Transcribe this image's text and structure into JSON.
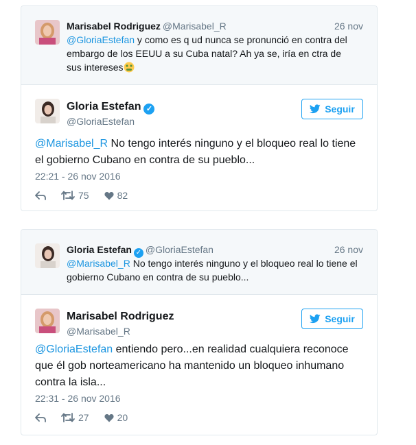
{
  "colors": {
    "link": "#1b95e0",
    "brand": "#1da1f2",
    "muted": "#657786"
  },
  "cards": [
    {
      "parent": {
        "name": "Marisabel Rodriguez",
        "handle": "@Marisabel_R",
        "date": "26 nov",
        "mention": "@GloriaEstefan",
        "text_lines": [
          " y como es q ud nunca se pronunció en contra del",
          "embargo de los EEUU a su Cuba natal? Ah ya se, iría en ctra de",
          "sus intereses"
        ],
        "emoji": "money-mouth-face-icon"
      },
      "main": {
        "name": "Gloria Estefan",
        "handle": "@GloriaEstefan",
        "follow_label": "Seguir",
        "mention": "@Marisabel_R",
        "text_lines": [
          " No tengo interés ninguno y el bloqueo real lo tiene",
          "el gobierno Cubano en contra de su pueblo..."
        ],
        "time": "22:21 - 26 nov 2016",
        "retweets": "75",
        "likes": "82"
      }
    },
    {
      "parent": {
        "name": "Gloria Estefan",
        "handle": "@GloriaEstefan",
        "date": "26 nov",
        "mention": "@Marisabel_R",
        "text_lines": [
          " No tengo interés ninguno y el bloqueo real lo tiene el",
          "gobierno Cubano en contra de su pueblo..."
        ]
      },
      "main": {
        "name": "Marisabel Rodriguez",
        "handle": "@Marisabel_R",
        "follow_label": "Seguir",
        "mention": "@GloriaEstefan",
        "text_lines": [
          " entiendo pero...en realidad cualquiera reconoce",
          "que él gob norteamericano ha mantenido un bloqueo inhumano",
          "contra la isla..."
        ],
        "time": "22:31 - 26 nov 2016",
        "retweets": "27",
        "likes": "20"
      }
    }
  ]
}
